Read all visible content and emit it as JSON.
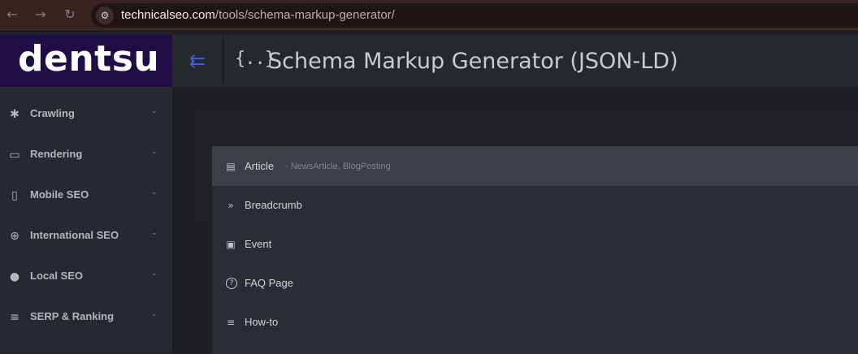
{
  "browser": {
    "back_icon": "←",
    "forward_icon": "→",
    "reload_icon": "↻",
    "site_info_icon": "⚙",
    "url_host": "technicalseo.com",
    "url_path": "/tools/schema-markup-generator/"
  },
  "sidebar": {
    "logo": "dentsu",
    "items": [
      {
        "label": "Crawling",
        "icon": "✱"
      },
      {
        "label": "Rendering",
        "icon": "▭"
      },
      {
        "label": "Mobile SEO",
        "icon": "▯"
      },
      {
        "label": "International SEO",
        "icon": "⊕"
      },
      {
        "label": "Local SEO",
        "icon": "●"
      },
      {
        "label": "SERP & Ranking",
        "icon": "≡"
      }
    ],
    "chevron": "⌄"
  },
  "header": {
    "toggle_icon": "⇇",
    "title_icon": "{..}",
    "title": "Schema Markup Generator (JSON-LD)"
  },
  "dropdown": {
    "items": [
      {
        "label": "Article",
        "sub": "- NewsArticle, BlogPosting",
        "icon": "▤"
      },
      {
        "label": "Breadcrumb",
        "sub": "",
        "icon": "»"
      },
      {
        "label": "Event",
        "sub": "",
        "icon": "▣"
      },
      {
        "label": "FAQ Page",
        "sub": "",
        "icon": "?"
      },
      {
        "label": "How-to",
        "sub": "",
        "icon": "≡"
      }
    ]
  }
}
